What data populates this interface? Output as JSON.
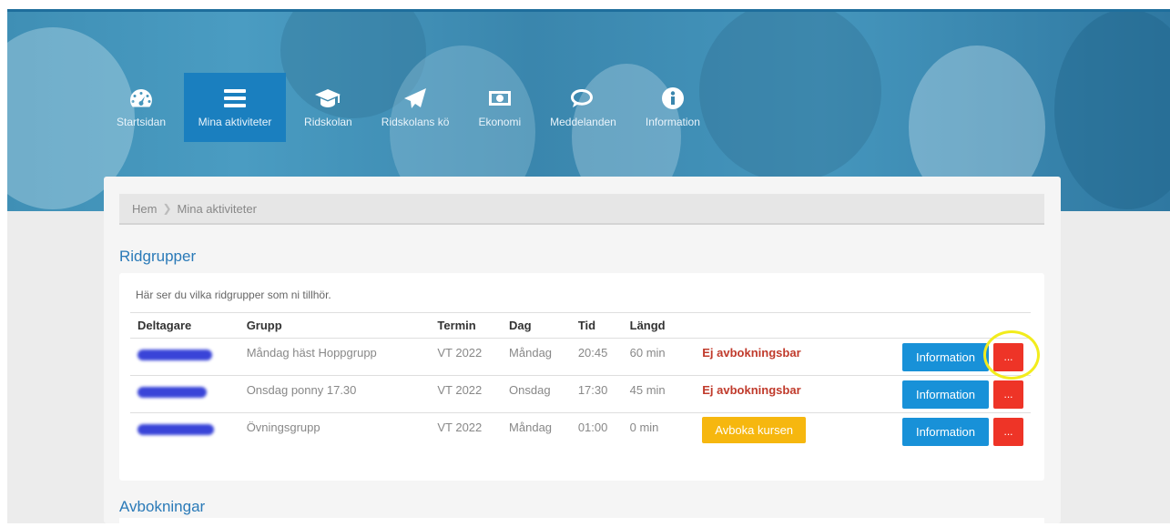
{
  "nav": {
    "items": [
      {
        "label": "Startsidan",
        "icon": "dashboard-icon"
      },
      {
        "label": "Mina aktiviteter",
        "icon": "menu-icon",
        "active": true
      },
      {
        "label": "Ridskolan",
        "icon": "graduation-cap-icon"
      },
      {
        "label": "Ridskolans kö",
        "icon": "paper-plane-icon"
      },
      {
        "label": "Ekonomi",
        "icon": "money-icon"
      },
      {
        "label": "Meddelanden",
        "icon": "chat-icon"
      },
      {
        "label": "Information",
        "icon": "info-icon"
      }
    ]
  },
  "breadcrumb": {
    "home": "Hem",
    "current": "Mina aktiviteter"
  },
  "ridgrupper": {
    "title": "Ridgrupper",
    "intro": "Här ser du vilka ridgrupper som ni tillhör.",
    "columns": [
      "Deltagare",
      "Grupp",
      "Termin",
      "Dag",
      "Tid",
      "Längd"
    ],
    "rows": [
      {
        "grupp": "Måndag häst Hoppgrupp",
        "termin": "VT 2022",
        "dag": "Måndag",
        "tid": "20:45",
        "langd": "60 min",
        "status": "Ej avbokningsbar",
        "info": "Information",
        "more": "..."
      },
      {
        "grupp": "Onsdag ponny 17.30",
        "termin": "VT 2022",
        "dag": "Onsdag",
        "tid": "17:30",
        "langd": "45 min",
        "status": "Ej avbokningsbar",
        "info": "Information",
        "more": "..."
      },
      {
        "grupp": "Övningsgrupp",
        "termin": "VT 2022",
        "dag": "Måndag",
        "tid": "01:00",
        "langd": "0 min",
        "cancel": "Avboka kursen",
        "info": "Information",
        "more": "..."
      }
    ]
  },
  "avbokningar": {
    "title": "Avbokningar"
  },
  "colors": {
    "primary": "#1891d8",
    "danger": "#ee3427",
    "warning": "#f6b70f",
    "heading": "#2a7ab8",
    "highlight": "#f2ec1d"
  }
}
